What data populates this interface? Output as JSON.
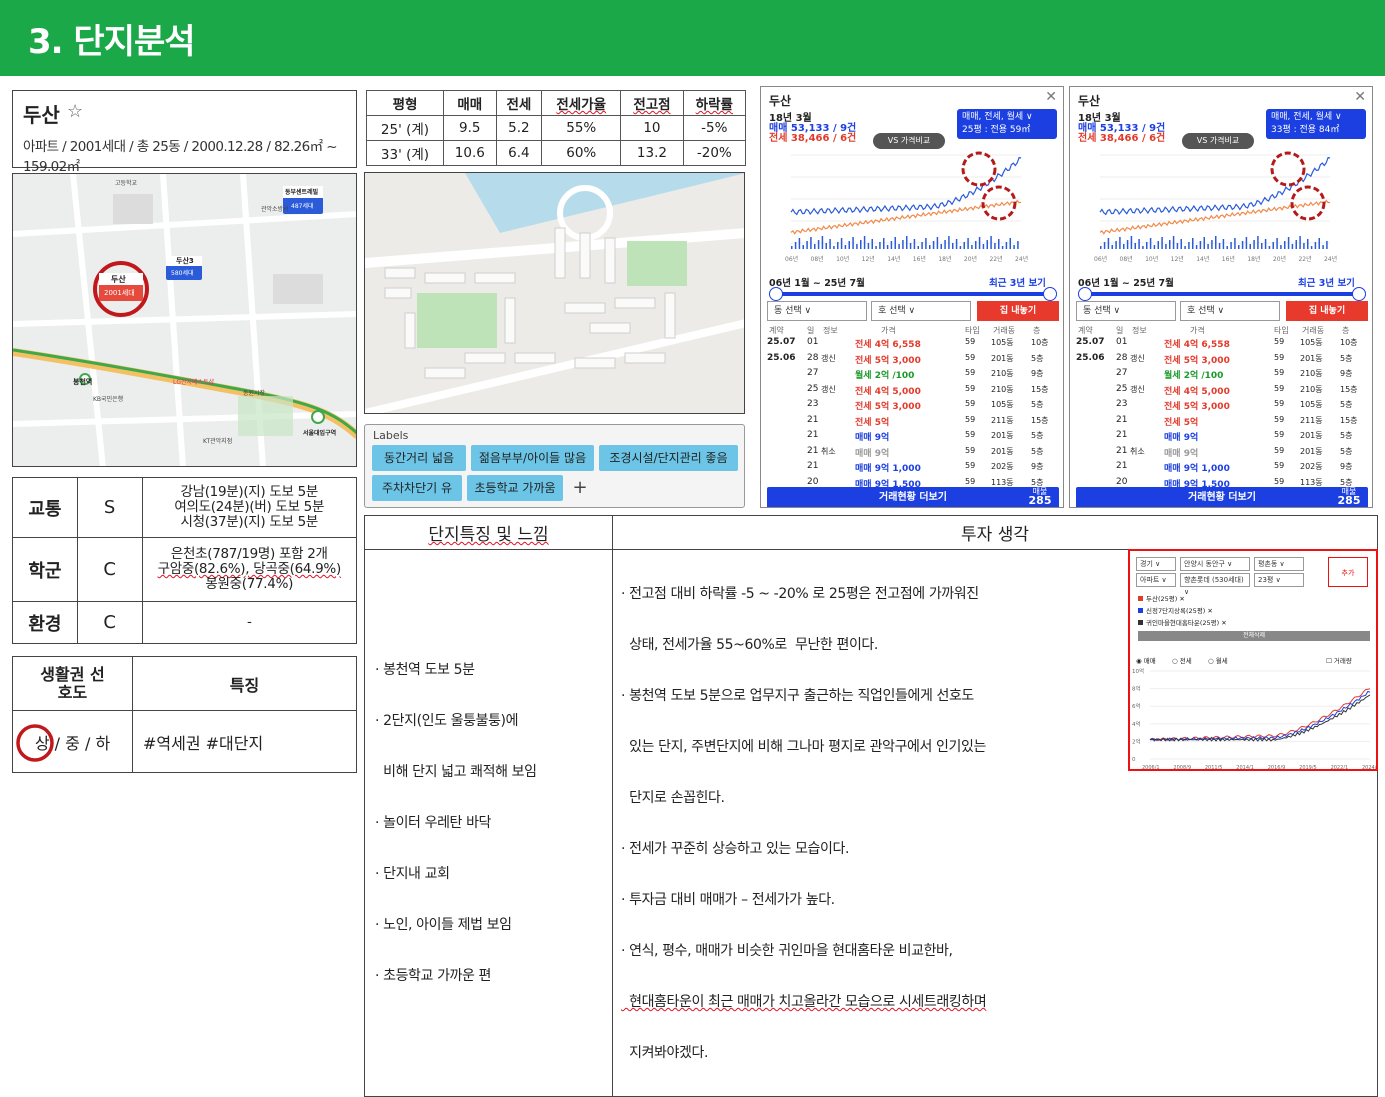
{
  "header": {
    "title": "3. 단지분석",
    "bg_color": "#1aa848"
  },
  "apt": {
    "name": "두산",
    "star": "☆",
    "info": "아파트 / 2001세대 / 총 25동 / 2000.12.28 / 82.26㎡ ~ 159.02㎡"
  },
  "price_table": {
    "headers": [
      "평형",
      "매매",
      "전세",
      "전세가율",
      "전고점",
      "하락률"
    ],
    "rows": [
      [
        "25' (계)",
        "9.5",
        "5.2",
        "55%",
        "10",
        "-5%"
      ],
      [
        "33' (계)",
        "10.6",
        "6.4",
        "60%",
        "13.2",
        "-20%"
      ]
    ]
  },
  "map": {
    "labels": {
      "market": "고등학교",
      "dusan_marker": "두산",
      "dusan_sub": "2001세대",
      "dusan3": "두산3",
      "dusan3_sub": "580세대",
      "dongbu": "동부센트레빌",
      "dongbu_sub": "487세대",
      "station": "봉천역",
      "kb": "KB국민은행",
      "lg": "LG전자베스트샵",
      "kt": "KT관악지점",
      "seoul_univ": "서울대입구역",
      "market2": "동원시장",
      "fire": "관악소방서"
    }
  },
  "ratings": [
    {
      "category": "교통",
      "grade": "S",
      "desc": [
        "강남(19분)(지) 도보 5분",
        "여의도(24분)(버) 도보 5분",
        "시청(37분)(지) 도보 5분"
      ]
    },
    {
      "category": "학군",
      "grade": "C",
      "desc": [
        "은천초(787/19명) 포함 2개",
        "구암중(82.6%), 당곡중(64.9%)",
        "봉원중(77.4%)"
      ]
    },
    {
      "category": "환경",
      "grade": "C",
      "desc": [
        "-"
      ]
    }
  ],
  "life": {
    "col1_header": "생활권 선호도",
    "col2_header": "특징",
    "level_high": "상",
    "level_mid": "중",
    "level_low": "하",
    "slash": "/",
    "tags": "#역세권 #대단지"
  },
  "labels_panel": {
    "title": "Labels",
    "chips": [
      "동간거리 넓음",
      "젊음부부/아이들 많음",
      "조경시설/단지관리 좋음",
      "주차차단기 유",
      "초등학교 가까움"
    ],
    "add": "+"
  },
  "phones": [
    {
      "title": "두산",
      "tag": "📄",
      "close": "✕",
      "date": "18년 3월",
      "sale": "매매 53,133 / 9건",
      "jeonse": "전세 38,466 / 6건",
      "badge_line1": "매매, 전세, 월세 ∨",
      "badge_line2": "25평 : 전용 59㎡",
      "vs": "VS 가격비교",
      "period": "06년 1월 ~ 25년 7월",
      "recent": "최근 3년 보기",
      "sel1": "동 선택 ∨",
      "sel2": "호 선택 ∨",
      "btn": "집 내놓기",
      "x_ticks": [
        "06년",
        "08년",
        "10년",
        "12년",
        "14년",
        "16년",
        "18년",
        "20년",
        "22년",
        "24년"
      ],
      "more": "거래현황 더보기",
      "more_count_label": "매물",
      "more_count": "285"
    },
    {
      "title": "두산",
      "tag": "📄",
      "close": "✕",
      "date": "18년 3월",
      "sale": "매매 53,133 / 9건",
      "jeonse": "전세 38,466 / 6건",
      "badge_line1": "매매, 전세, 월세 ∨",
      "badge_line2": "33평 : 전용 84㎡",
      "vs": "VS 가격비교",
      "period": "06년 1월 ~ 25년 7월",
      "recent": "최근 3년 보기",
      "sel1": "동 선택 ∨",
      "sel2": "호 선택 ∨",
      "btn": "집 내놓기",
      "x_ticks": [
        "06년",
        "08년",
        "10년",
        "12년",
        "14년",
        "16년",
        "18년",
        "20년",
        "22년",
        "24년"
      ],
      "more": "거래현황 더보기",
      "more_count_label": "매물",
      "more_count": "285"
    }
  ],
  "tx_headers": [
    "계약",
    "일",
    "정보",
    "가격",
    "타입",
    "거래동",
    "층"
  ],
  "transactions": [
    [
      "25.07",
      "01",
      "",
      "전세 4억 6,558",
      "59",
      "105동",
      "10층",
      "red"
    ],
    [
      "25.06",
      "28",
      "갱신",
      "전세 5억 3,000",
      "59",
      "201동",
      "5층",
      "red"
    ],
    [
      "",
      "27",
      "",
      "월세 2억 /100",
      "59",
      "210동",
      "9층",
      "green"
    ],
    [
      "",
      "25",
      "갱신",
      "전세 4억 5,000",
      "59",
      "210동",
      "15층",
      "red"
    ],
    [
      "",
      "23",
      "",
      "전세 5억 3,000",
      "59",
      "105동",
      "5층",
      "red"
    ],
    [
      "",
      "21",
      "",
      "전세 5억",
      "59",
      "211동",
      "15층",
      "red"
    ],
    [
      "",
      "21",
      "",
      "매매 9억",
      "59",
      "201동",
      "5층",
      "blue"
    ],
    [
      "",
      "21",
      "취소",
      "매매 9억",
      "59",
      "201동",
      "5층",
      "gray"
    ],
    [
      "",
      "21",
      "",
      "매매 9억 1,000",
      "59",
      "202동",
      "9층",
      "blue"
    ],
    [
      "",
      "20",
      "",
      "매매 9억 1,500",
      "59",
      "113동",
      "5층",
      "blue"
    ]
  ],
  "features": {
    "header": "단지특징 및 느낌",
    "items": [
      "· 봉천역 도보 5분",
      "· 2단지(인도 울퉁불퉁)에",
      "  비해 단지 넓고 쾌적해 보임",
      "· 놀이터 우레탄 바닥",
      "· 단지내 교회",
      "· 노인, 아이들 제법 보임",
      "· 초등학교 가까운 편"
    ]
  },
  "investment": {
    "header": "투자 생각",
    "lines": [
      "· 전고점 대비 하락률 -5 ~ -20% 로 25평은 전고점에 가까워진",
      "  상태, 전세가율 55~60%로  무난한 편이다.",
      "· 봉천역 도보 5분으로 업무지구 출근하는 직업인들에게 선호도",
      "  있는 단지, 주변단지에 비해 그나마 평지로 관악구에서 인기있는",
      "  단지로 손꼽힌다.",
      "· 전세가 꾸준히 상승하고 있는 모습이다.",
      "· 투자금 대비 매매가 – 전세가가 높다.",
      "· 연식, 평수, 매매가 비슷한 귀인마을 현대홈타운 비교한바,",
      "  현대홈타운이 최근 매매가 치고올라간 모습으로 시세트래킹하며",
      "  지켜봐야겠다."
    ]
  },
  "mini": {
    "sel1": "경기 ∨",
    "sel2": "안양시 동안구 ∨",
    "sel3": "평촌동 ∨",
    "sel4": "아파트 ∨",
    "sel5": "향촌롯데 (530세대) ∨",
    "sel6": "23평 ∨",
    "add": "추가",
    "items": [
      "두산(25평) ✕",
      "신정7단지상록(25평) ✕",
      "귀인마을현대홈타운(25평) ✕"
    ],
    "item_colors": [
      "#e23a2a",
      "#1b3fe0",
      "#333333"
    ],
    "delete_all": "전체삭제",
    "radio1": "매매",
    "radio2": "전세",
    "radio3": "월세",
    "checkbox": "거래량",
    "y_ticks": [
      "10억",
      "8억",
      "6억",
      "4억",
      "2억",
      "0"
    ],
    "x_ticks": [
      "2006/1",
      "2008/9",
      "2011/5",
      "2014/1",
      "2016/9",
      "2019/5",
      "2022/1",
      "2024/9"
    ]
  }
}
